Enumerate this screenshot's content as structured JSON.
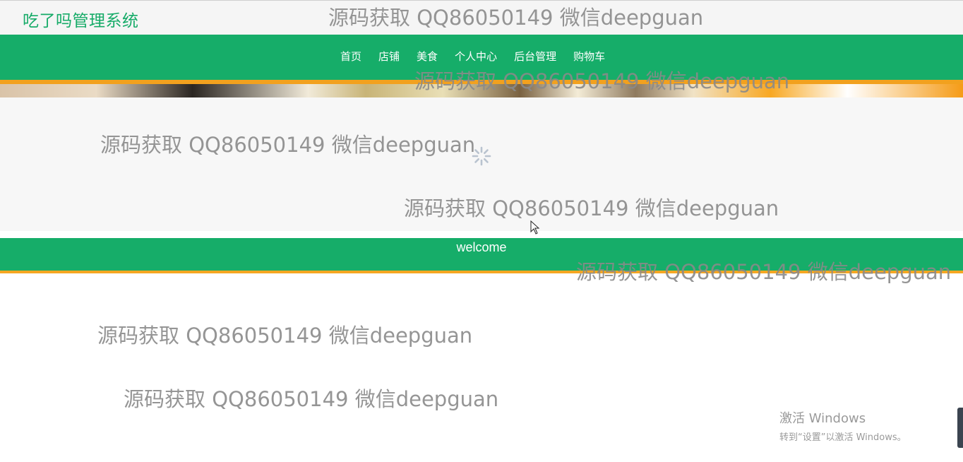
{
  "header": {
    "site_title": "吃了吗管理系统"
  },
  "nav": {
    "items": [
      {
        "label": "首页",
        "name": "nav-item-home"
      },
      {
        "label": "店铺",
        "name": "nav-item-shops"
      },
      {
        "label": "美食",
        "name": "nav-item-food"
      },
      {
        "label": "个人中心",
        "name": "nav-item-profile"
      },
      {
        "label": "后台管理",
        "name": "nav-item-admin"
      },
      {
        "label": "购物车",
        "name": "nav-item-cart"
      }
    ]
  },
  "welcome": {
    "text": "welcome"
  },
  "watermarks": [
    "源码获取 QQ86050149 微信deepguan",
    "源码获取 QQ86050149 微信deepguan",
    "源码获取 QQ86050149 微信deepguan",
    "源码获取 QQ86050149 微信deepguan",
    "源码获取 QQ86050149 微信deepguan",
    "源码获取 QQ86050149 微信deepguan",
    "源码获取 QQ86050149 微信deepguan"
  ],
  "windows_activation": {
    "title": "激活 Windows",
    "subtitle": "转到“设置”以激活 Windows。"
  },
  "colors": {
    "brand_green": "#16ad69",
    "accent_orange": "#f5a623"
  }
}
